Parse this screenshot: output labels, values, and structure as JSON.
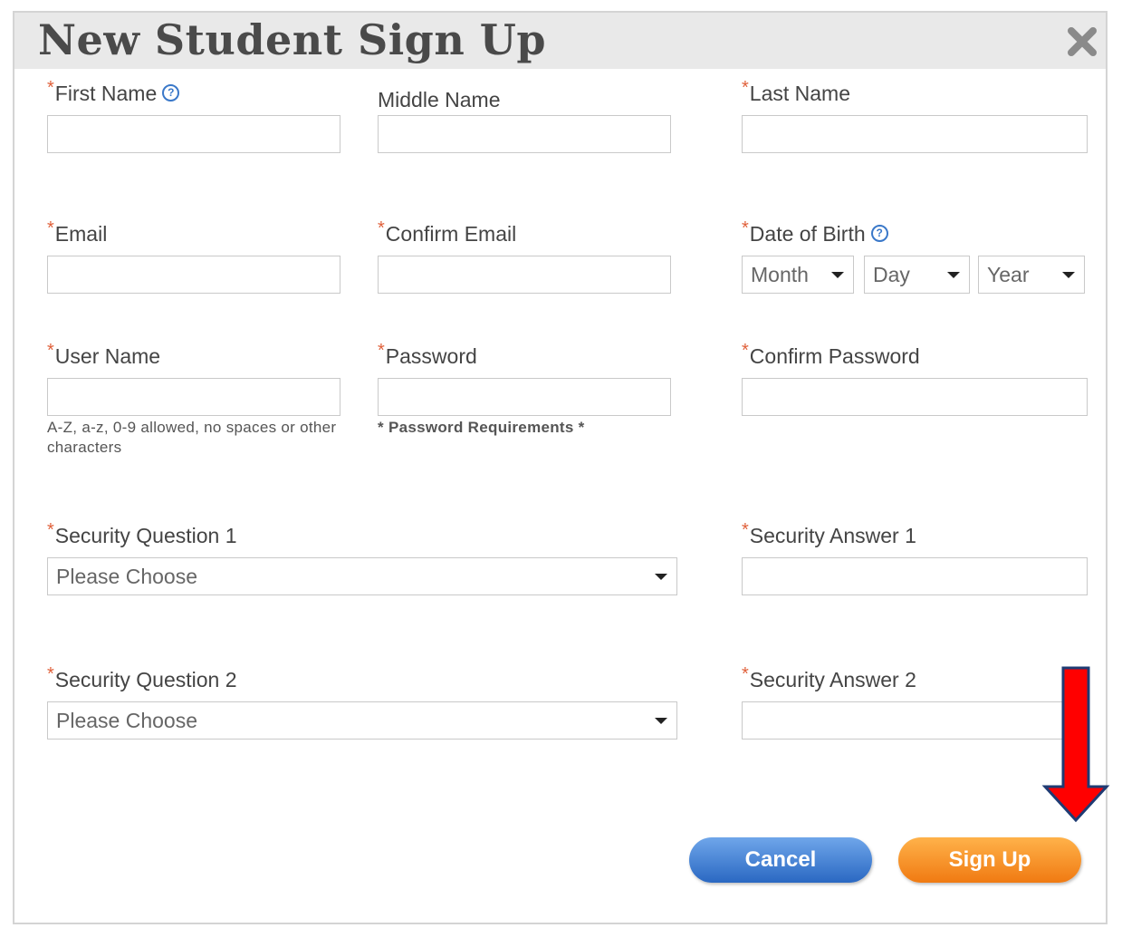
{
  "dialog": {
    "title": "New Student Sign Up",
    "close_icon": "close-icon"
  },
  "fields": {
    "first_name": {
      "label": "First Name",
      "required": true,
      "help": true,
      "value": ""
    },
    "middle_name": {
      "label": "Middle Name",
      "required": false,
      "value": ""
    },
    "last_name": {
      "label": "Last Name",
      "required": true,
      "value": ""
    },
    "email": {
      "label": "Email",
      "required": true,
      "value": ""
    },
    "confirm_email": {
      "label": "Confirm Email",
      "required": true,
      "value": ""
    },
    "date_of_birth": {
      "label": "Date of Birth",
      "required": true,
      "help": true,
      "month": "Month",
      "day": "Day",
      "year": "Year"
    },
    "user_name": {
      "label": "User Name",
      "required": true,
      "value": "",
      "hint": "A-Z, a-z, 0-9 allowed, no spaces or other characters"
    },
    "password": {
      "label": "Password",
      "required": true,
      "value": "",
      "hint": "* Password Requirements *"
    },
    "confirm_password": {
      "label": "Confirm Password",
      "required": true,
      "value": ""
    },
    "security_question_1": {
      "label": "Security Question 1",
      "required": true,
      "selected": "Please Choose"
    },
    "security_answer_1": {
      "label": "Security Answer 1",
      "required": true,
      "value": ""
    },
    "security_question_2": {
      "label": "Security Question 2",
      "required": true,
      "selected": "Please Choose"
    },
    "security_answer_2": {
      "label": "Security Answer 2",
      "required": true,
      "value": ""
    }
  },
  "buttons": {
    "cancel": "Cancel",
    "sign_up": "Sign Up"
  },
  "colors": {
    "required_asterisk": "#e0603a",
    "help_icon": "#3a78c9",
    "cancel_button": "#2a68c2",
    "signup_button": "#f07a12",
    "annotation_arrow": "#ff0000"
  },
  "required_marker": "*",
  "help_marker": "?"
}
